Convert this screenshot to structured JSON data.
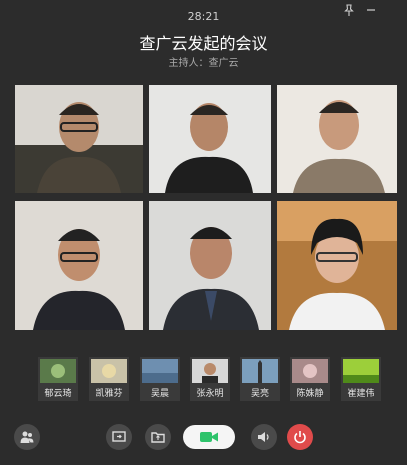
{
  "header": {
    "timer": "28:21",
    "title": "查广云发起的会议",
    "host_label": "主持人：查广云"
  },
  "participants": [
    {
      "name": "郁云琦"
    },
    {
      "name": "凯雅芬"
    },
    {
      "name": "吴晨"
    },
    {
      "name": "张永明"
    },
    {
      "name": "吴亮"
    },
    {
      "name": "陈姝静"
    },
    {
      "name": "崔建伟"
    }
  ],
  "icons": {
    "pin": "pin-icon",
    "minimize": "minimize-icon",
    "members": "members-icon",
    "share": "share-screen-icon",
    "file": "file-share-icon",
    "camera": "camera-icon",
    "speaker": "speaker-icon",
    "end": "power-icon"
  },
  "colors": {
    "background": "#2c2c2c",
    "camera_active": "#2ec36b",
    "end_call": "#e04b4b"
  }
}
